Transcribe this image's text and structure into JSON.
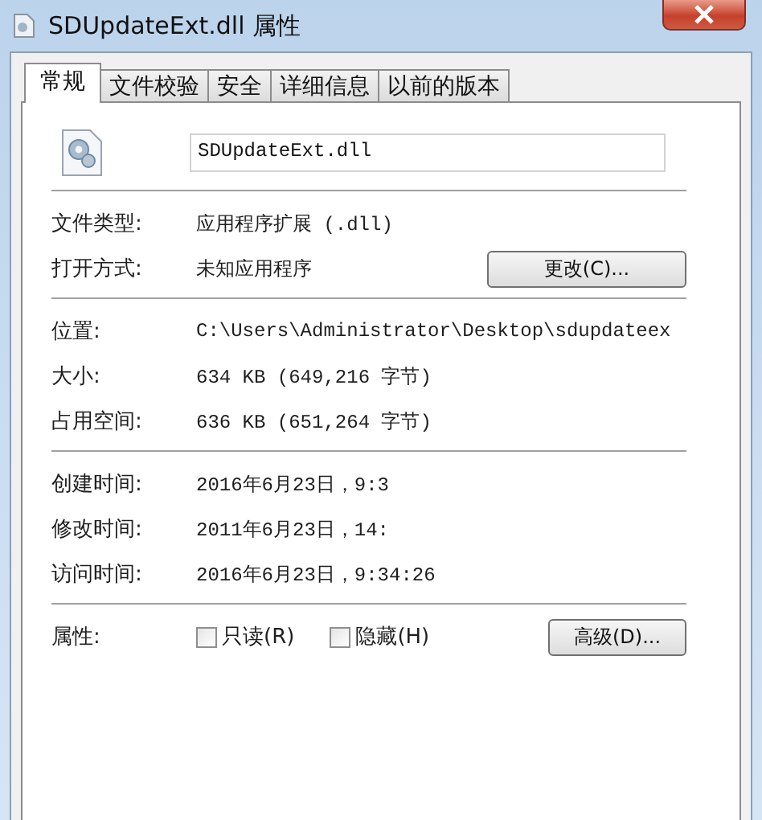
{
  "window": {
    "title": "SDUpdateExt.dll 属性"
  },
  "tabs": [
    {
      "label": "常规",
      "selected": true
    },
    {
      "label": "文件校验",
      "selected": false
    },
    {
      "label": "安全",
      "selected": false
    },
    {
      "label": "详细信息",
      "selected": false
    },
    {
      "label": "以前的版本",
      "selected": false
    }
  ],
  "file_name": "SDUpdateExt.dll",
  "sections": [
    [
      {
        "kind": "value",
        "label": "文件类型:",
        "value": "应用程序扩展 (.dll)"
      },
      {
        "kind": "value",
        "label": "打开方式:",
        "value": "未知应用程序",
        "button": "更改(C)..."
      }
    ],
    [
      {
        "kind": "value",
        "label": "位置:",
        "value": "C:\\Users\\Administrator\\Desktop\\sdupdateex"
      },
      {
        "kind": "value",
        "label": "大小:",
        "value": "634 KB (649,216 字节)"
      },
      {
        "kind": "value",
        "label": "占用空间:",
        "value": "636 KB (651,264 字节)"
      }
    ],
    [
      {
        "kind": "value",
        "label": "创建时间:",
        "value": "2016年6月23日，9:3"
      },
      {
        "kind": "value",
        "label": "修改时间:",
        "value": "2011年6月23日，14:"
      },
      {
        "kind": "value",
        "label": "访问时间:",
        "value": "2016年6月23日，9:34:26"
      }
    ],
    [
      {
        "kind": "checkboxes",
        "label": "属性:",
        "checkboxes": [
          {
            "label": "只读(R)",
            "checked": false
          },
          {
            "label": "隐藏(H)",
            "checked": false
          }
        ],
        "button": "高级(D)..."
      }
    ]
  ]
}
